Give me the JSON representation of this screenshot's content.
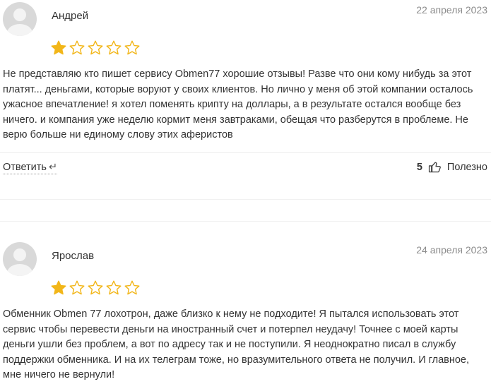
{
  "reviews": [
    {
      "author": "Андрей",
      "date": "22 апреля 2023",
      "rating": 1,
      "max_rating": 5,
      "text": "Не представляю кто пишет сервису Obmen77 хорошие отзывы! Разве что они кому нибудь за этот платят... деньгами, которые воруют у своих клиентов. Но лично у меня об этой компании осталось ужасное впечатление! я хотел поменять крипту на доллары, а в результате остался вообще без ничего. и компания уже неделю кормит меня завтраками, обещая что разберутся в проблеме. Не верю больше ни единому слову этих аферистов",
      "reply_label": "Ответить",
      "likes": "5",
      "useful_label": "Полезно"
    },
    {
      "author": "Ярослав",
      "date": "24 апреля 2023",
      "rating": 1,
      "max_rating": 5,
      "text": "Обменник Obmen 77 лохотрон, даже близко к нему не подходите! Я пытался использовать этот сервис чтобы перевести деньги на иностранный счет и потерпел неудачу! Точнее с моей карты деньги ушли без проблем, а вот по адресу так и не поступили. Я неоднократно писал в службу поддержки обменника. И на их телеграм тоже, но вразумительного ответа не получил. И главное, мне ничего не вернули!"
    }
  ],
  "icons": {
    "star_filled_color": "#f2b619",
    "star_empty_color": "#f2b619",
    "reply": "reply-arrow-icon",
    "like": "thumbs-up-icon"
  }
}
